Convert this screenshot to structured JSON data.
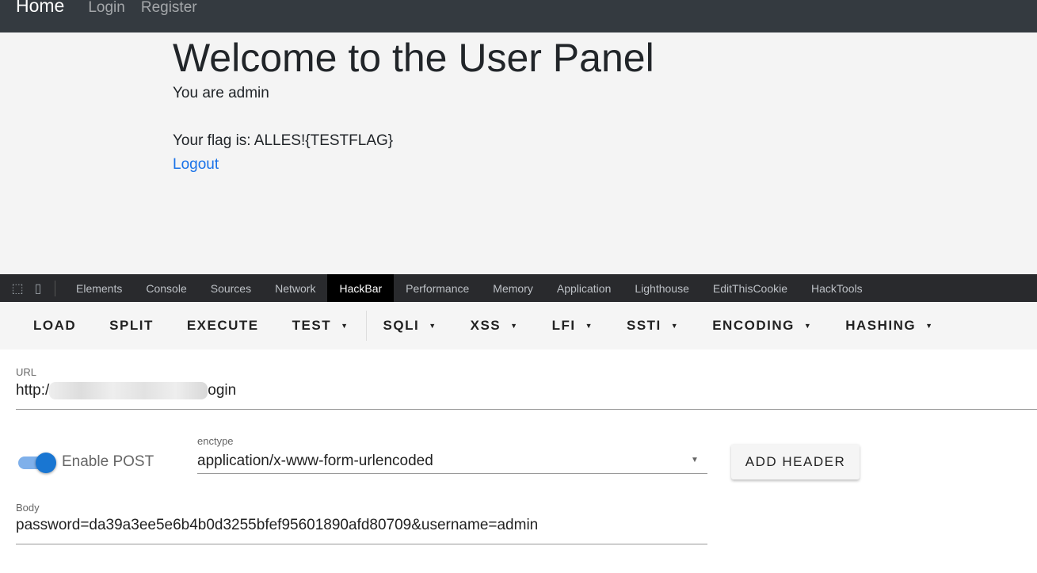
{
  "navbar": {
    "brand": "Home",
    "links": [
      "Login",
      "Register"
    ]
  },
  "page": {
    "title": "Welcome to the User Panel",
    "role_text": "You are admin",
    "flag_text": "Your flag is: ALLES!{TESTFLAG}",
    "logout": "Logout"
  },
  "devtools": {
    "icons": [
      "inspect-element-icon",
      "device-toolbar-icon"
    ],
    "tabs": [
      "Elements",
      "Console",
      "Sources",
      "Network",
      "HackBar",
      "Performance",
      "Memory",
      "Application",
      "Lighthouse",
      "EditThisCookie",
      "HackTools"
    ],
    "active_tab": "HackBar"
  },
  "hackbar": {
    "toolbar": [
      {
        "label": "LOAD"
      },
      {
        "label": "SPLIT"
      },
      {
        "label": "EXECUTE"
      },
      {
        "label": "TEST",
        "dropdown": true
      },
      {
        "label": "SQLI",
        "dropdown": true
      },
      {
        "label": "XSS",
        "dropdown": true
      },
      {
        "label": "LFI",
        "dropdown": true
      },
      {
        "label": "SSTI",
        "dropdown": true
      },
      {
        "label": "ENCODING",
        "dropdown": true
      },
      {
        "label": "HASHING",
        "dropdown": true
      }
    ],
    "url_label": "URL",
    "url_prefix": "http:/",
    "url_suffix": "ogin",
    "enable_post_label": "Enable POST",
    "enable_post": true,
    "enctype_label": "enctype",
    "enctype_value": "application/x-www-form-urlencoded",
    "add_header": "ADD HEADER",
    "body_label": "Body",
    "body_value": "password=da39a3ee5e6b4b0d3255bfef95601890afd80709&username=admin"
  },
  "colors": {
    "accent": "#1976d2",
    "link": "#1a73e8",
    "navbar": "#343a40"
  }
}
